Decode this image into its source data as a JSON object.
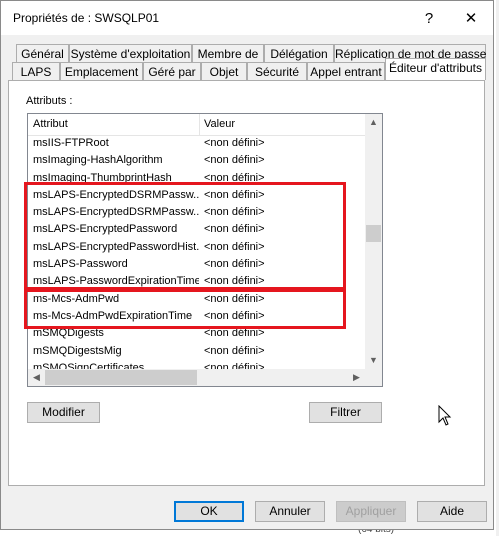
{
  "window": {
    "title": "Propriétés de : SWSQLP01",
    "help_glyph": "?",
    "close_glyph": "✕"
  },
  "tabs_row1": [
    "Général",
    "Système d'exploitation",
    "Membre de",
    "Délégation",
    "Réplication de mot de passe"
  ],
  "tabs_row2": [
    "LAPS",
    "Emplacement",
    "Géré par",
    "Objet",
    "Sécurité",
    "Appel entrant",
    "Éditeur d'attributs"
  ],
  "active_tab": "Éditeur d'attributs",
  "attributes_label": "Attributs :",
  "list": {
    "col_attribute": "Attribut",
    "col_value": "Valeur",
    "rows": [
      {
        "attr": "msIIS-FTPRoot",
        "value": "<non défini>"
      },
      {
        "attr": "msImaging-HashAlgorithm",
        "value": "<non défini>"
      },
      {
        "attr": "msImaging-ThumbprintHash",
        "value": "<non défini>"
      },
      {
        "attr": "msLAPS-EncryptedDSRMPassw...",
        "value": "<non défini>"
      },
      {
        "attr": "msLAPS-EncryptedDSRMPassw...",
        "value": "<non défini>"
      },
      {
        "attr": "msLAPS-EncryptedPassword",
        "value": "<non défini>"
      },
      {
        "attr": "msLAPS-EncryptedPasswordHist...",
        "value": "<non défini>"
      },
      {
        "attr": "msLAPS-Password",
        "value": "<non défini>"
      },
      {
        "attr": "msLAPS-PasswordExpirationTime",
        "value": "<non défini>"
      },
      {
        "attr": "ms-Mcs-AdmPwd",
        "value": "<non défini>"
      },
      {
        "attr": "ms-Mcs-AdmPwdExpirationTime",
        "value": "<non défini>"
      },
      {
        "attr": "mSMQDigests",
        "value": "<non défini>"
      },
      {
        "attr": "mSMQDigestsMig",
        "value": "<non défini>"
      },
      {
        "attr": "mSMQSignCertificates",
        "value": "<non défini>"
      }
    ]
  },
  "highlight_color": "#e5161e",
  "buttons": {
    "modify": "Modifier",
    "filter": "Filtrer",
    "ok": "OK",
    "cancel": "Annuler",
    "apply": "Appliquer",
    "help": "Aide"
  },
  "background_text": "(64 bits)"
}
